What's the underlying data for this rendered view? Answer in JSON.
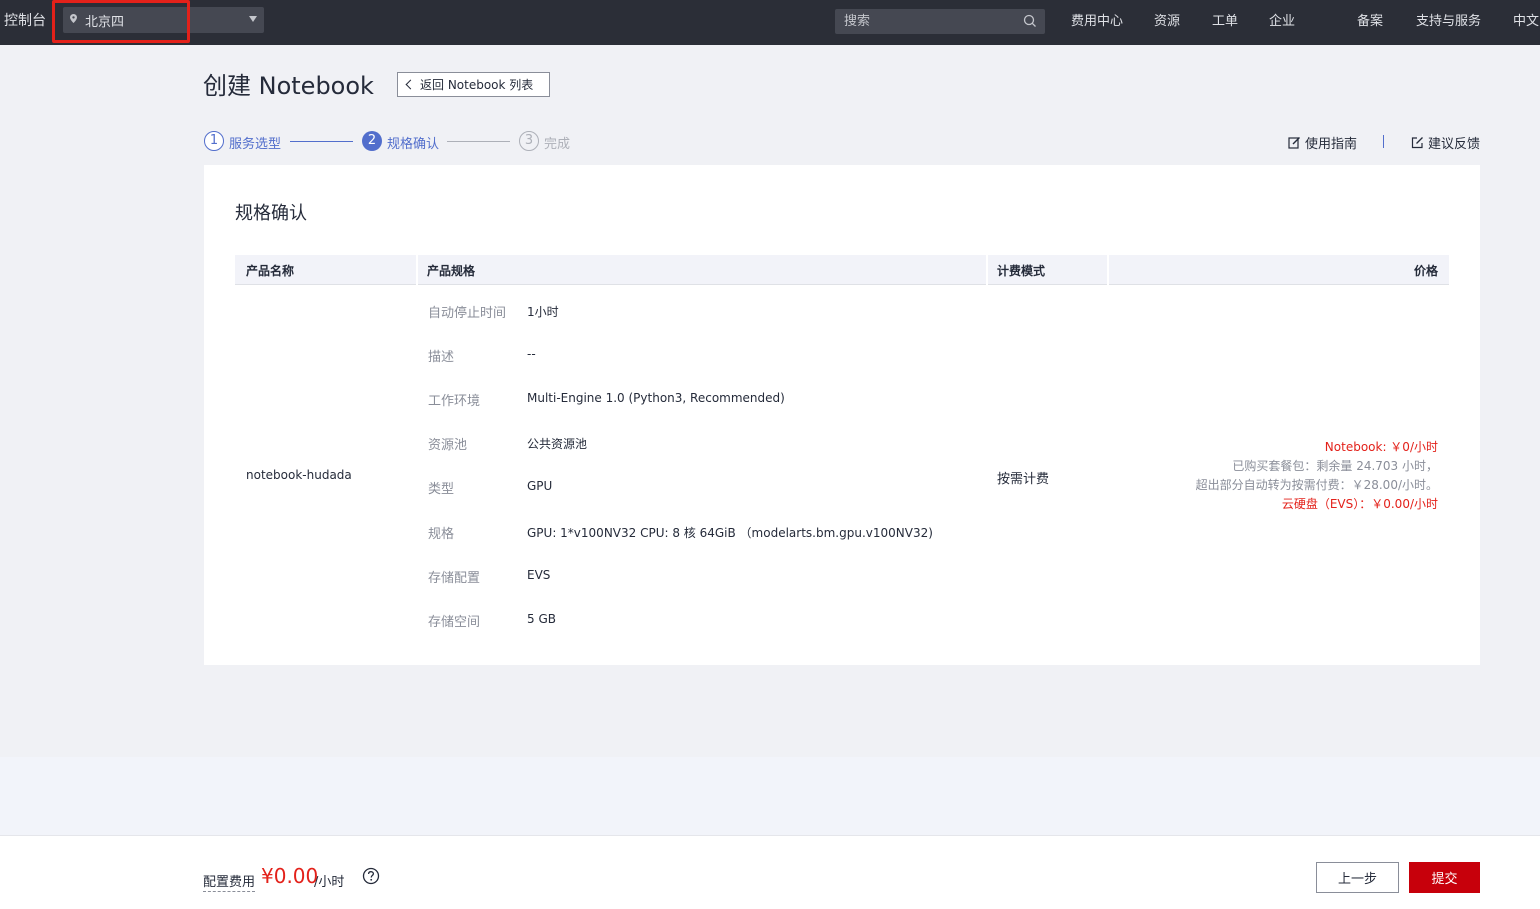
{
  "topbar": {
    "console": "控制台",
    "region": "北京四",
    "search_placeholder": "搜索",
    "nav": [
      "费用中心",
      "资源",
      "工单",
      "企业",
      "备案",
      "支持与服务",
      "中文"
    ]
  },
  "header": {
    "title": "创建 Notebook",
    "back_label": "返回 Notebook 列表",
    "guide": "使用指南",
    "feedback": "建议反馈"
  },
  "steps": [
    {
      "num": "1",
      "label": "服务选型",
      "state": "done"
    },
    {
      "num": "2",
      "label": "规格确认",
      "state": "active"
    },
    {
      "num": "3",
      "label": "完成",
      "state": "todo"
    }
  ],
  "card": {
    "title": "规格确认",
    "columns": {
      "name": "产品名称",
      "spec": "产品规格",
      "billing": "计费模式",
      "price": "价格"
    },
    "product_name": "notebook-hudada",
    "specs": [
      {
        "key": "自动停止时间",
        "value": "1小时"
      },
      {
        "key": "描述",
        "value": "--"
      },
      {
        "key": "工作环境",
        "value": "Multi-Engine 1.0 (Python3, Recommended)"
      },
      {
        "key": "资源池",
        "value": "公共资源池"
      },
      {
        "key": "类型",
        "value": "GPU"
      },
      {
        "key": "规格",
        "value": "GPU: 1*v100NV32 CPU: 8 核 64GiB （modelarts.bm.gpu.v100NV32)"
      },
      {
        "key": "存储配置",
        "value": "EVS"
      },
      {
        "key": "存储空间",
        "value": "5 GB"
      }
    ],
    "billing_mode": "按需计费",
    "price": {
      "notebook": "Notebook: ￥0/小时",
      "package": "已购买套餐包：剩余量 24.703 小时，",
      "overflow": "超出部分自动转为按需付费：￥28.00/小时。",
      "evs": "云硬盘（EVS）：￥0.00/小时"
    }
  },
  "footer": {
    "fee_label": "配置费用",
    "fee_amount": "¥0.00",
    "fee_unit": "/小时",
    "prev_label": "上一步",
    "submit_label": "提交"
  },
  "colors": {
    "topbar_bg": "#2b2e37",
    "accent_blue": "#526ecc",
    "price_red": "#e3211a",
    "submit_red": "#c7000b",
    "highlight_red": "#e3211a"
  }
}
